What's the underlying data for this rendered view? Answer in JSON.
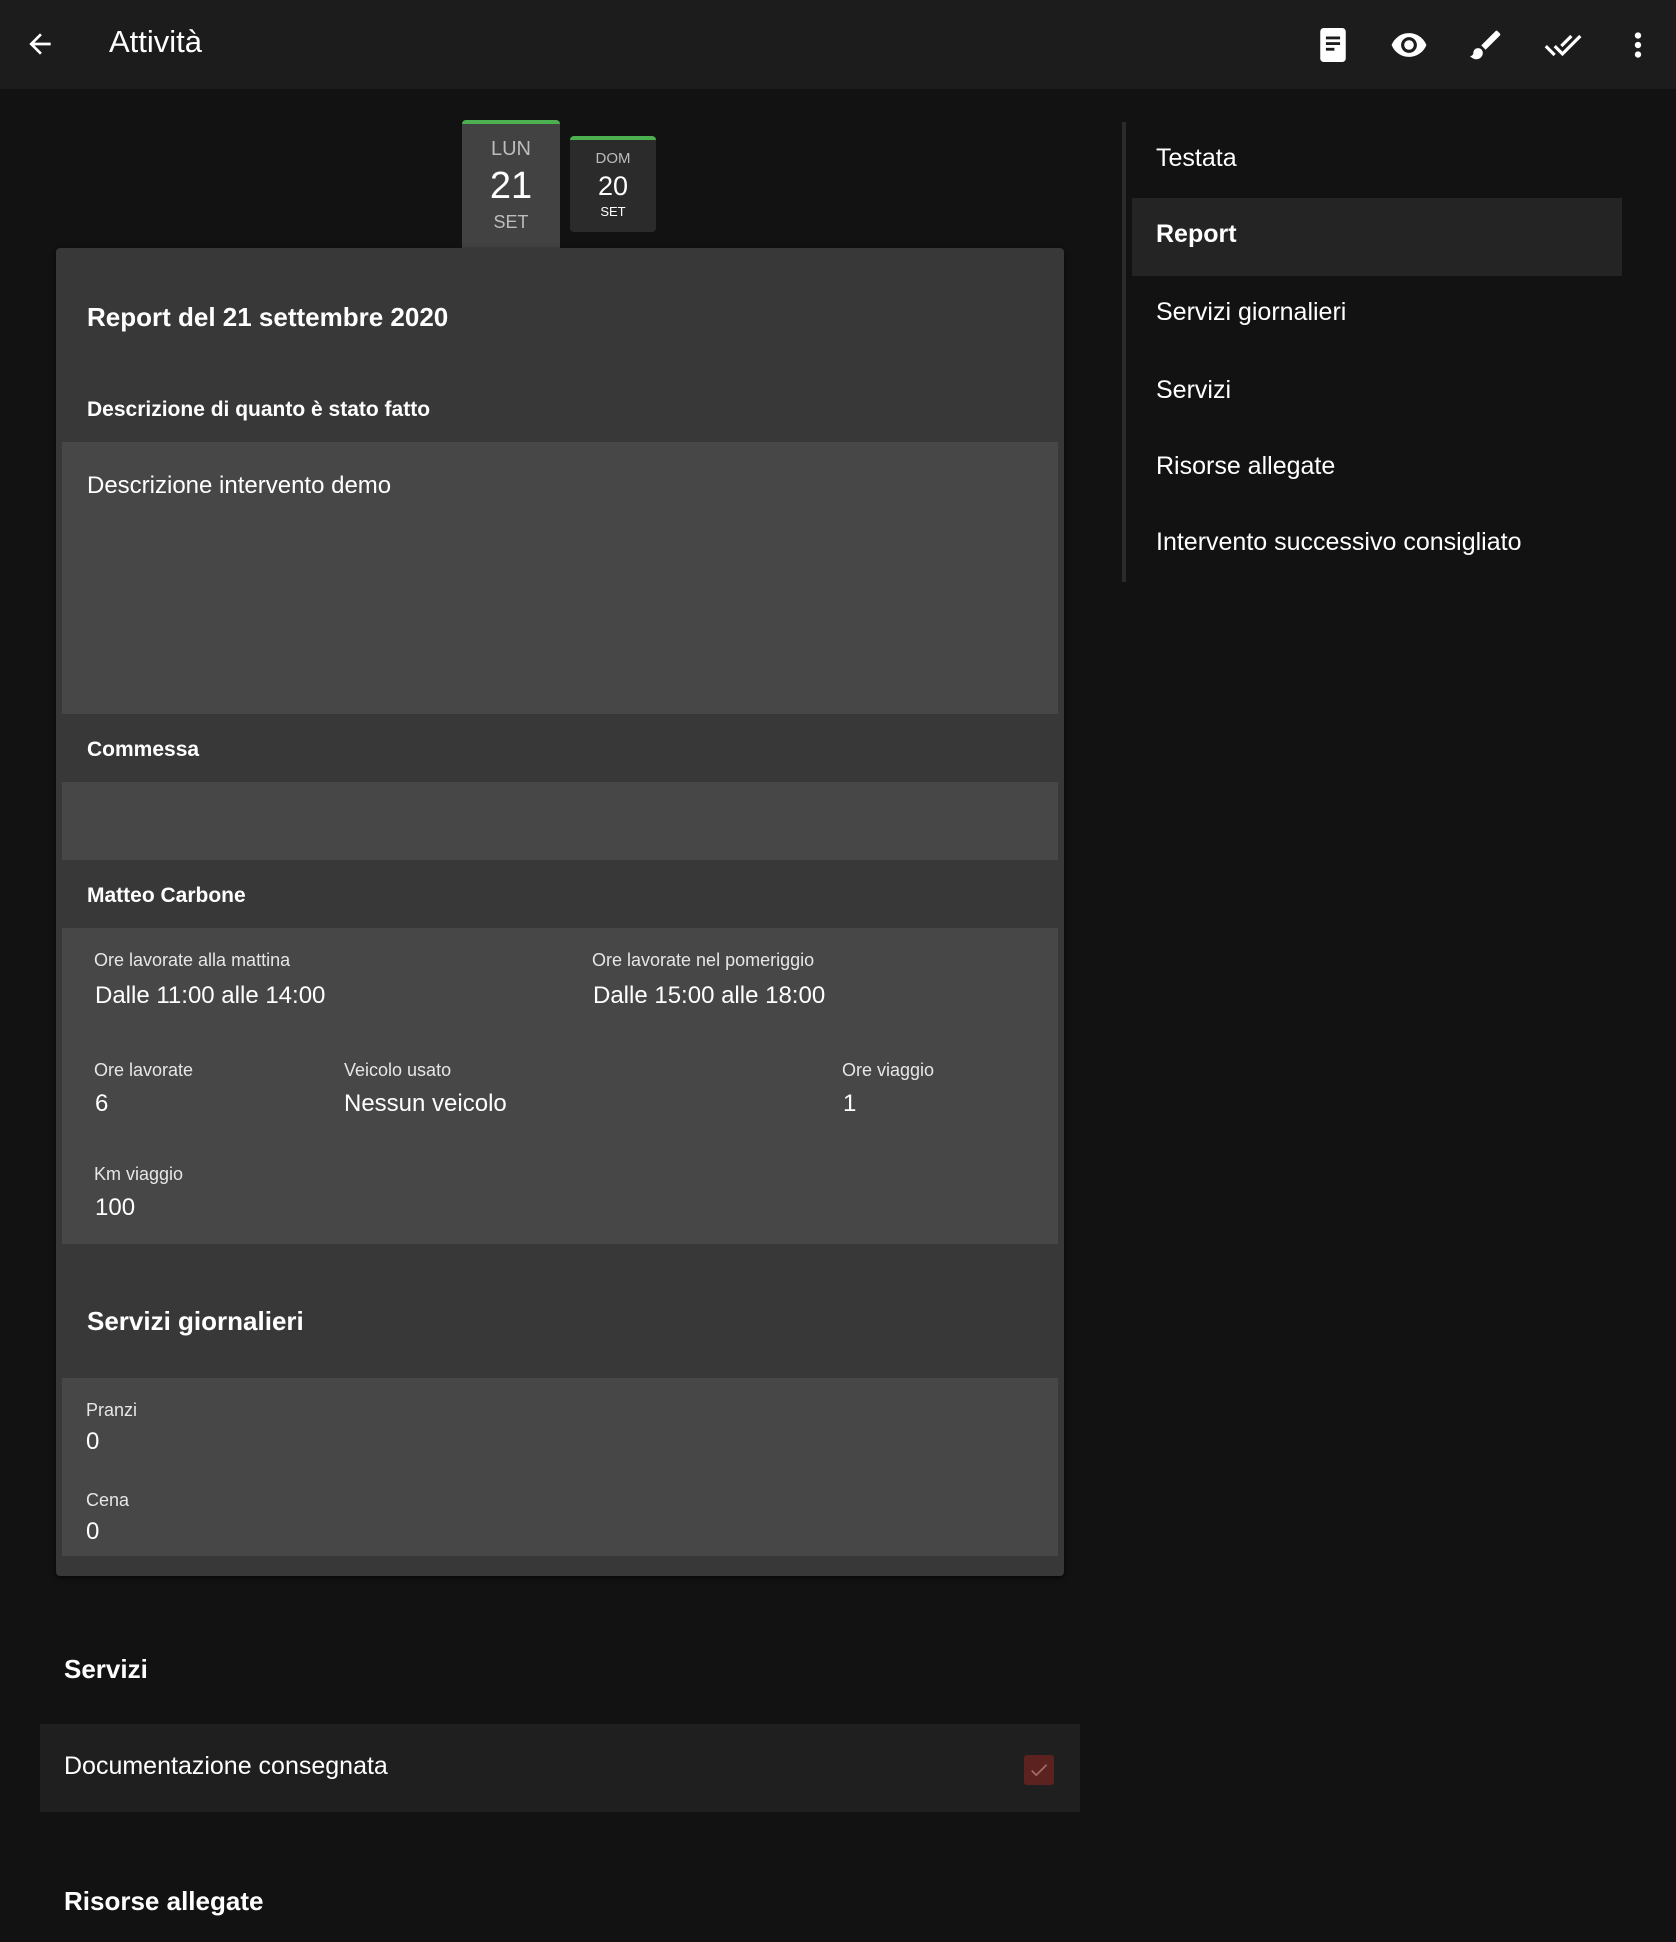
{
  "appbar": {
    "title": "Attività",
    "icons": [
      "arrow-back-icon",
      "document-icon",
      "eye-icon",
      "brush-icon",
      "double-check-icon",
      "more-vert-icon"
    ]
  },
  "tabs": [
    {
      "dow": "LUN",
      "day": "21",
      "mon": "SET",
      "active": true
    },
    {
      "dow": "DOM",
      "day": "20",
      "mon": "SET",
      "active": false
    }
  ],
  "report": {
    "title": "Report del 21 settembre 2020",
    "description_label": "Descrizione di quanto è stato fatto",
    "description_value": "Descrizione intervento demo",
    "commessa_label": "Commessa",
    "commessa_value": "",
    "person_name": "Matteo Carbone",
    "morning_label": "Ore lavorate alla mattina",
    "morning_value": "Dalle 11:00 alle 14:00",
    "afternoon_label": "Ore lavorate nel pomeriggio",
    "afternoon_value": "Dalle 15:00 alle 18:00",
    "hours_label": "Ore lavorate",
    "hours_value": "6",
    "vehicle_label": "Veicolo usato",
    "vehicle_value": "Nessun veicolo",
    "travel_hours_label": "Ore viaggio",
    "travel_hours_value": "1",
    "km_label": "Km viaggio",
    "km_value": "100"
  },
  "daily_services": {
    "title": "Servizi giornalieri",
    "lunch_label": "Pranzi",
    "lunch_value": "0",
    "dinner_label": "Cena",
    "dinner_value": "0"
  },
  "services": {
    "title": "Servizi",
    "items": [
      {
        "label": "Documentazione consegnata",
        "checked": true
      }
    ]
  },
  "attachments": {
    "title": "Risorse allegate"
  },
  "toc": {
    "items": [
      {
        "label": "Testata",
        "active": false
      },
      {
        "label": "Report",
        "active": true
      },
      {
        "label": "Servizi giornalieri",
        "active": false
      },
      {
        "label": "Servizi",
        "active": false
      },
      {
        "label": "Risorse allegate",
        "active": false
      },
      {
        "label": "Intervento successivo consigliato",
        "active": false
      }
    ]
  },
  "colors": {
    "accent": "#4caf50",
    "background": "#121212",
    "card": "#383838",
    "field": "#474747",
    "checkbox": "#5b2220"
  }
}
